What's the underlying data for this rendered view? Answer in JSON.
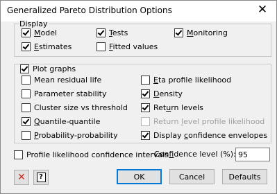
{
  "window": {
    "title": "Generalized Pareto Distribution Options",
    "close_glyph": "✕"
  },
  "display": {
    "legend": "Display",
    "items": [
      {
        "label_pre": "",
        "label_u": "M",
        "label_post": "odel",
        "checked": true
      },
      {
        "label_pre": "",
        "label_u": "T",
        "label_post": "ests",
        "checked": true
      },
      {
        "label_pre": "",
        "label_u": "M",
        "label_post": "onitoring",
        "checked": true
      },
      {
        "label_pre": "",
        "label_u": "E",
        "label_post": "stimates",
        "checked": true
      },
      {
        "label_pre": "",
        "label_u": "F",
        "label_post": "itted values",
        "checked": false
      }
    ]
  },
  "plot": {
    "legend": "Plot graphs",
    "checked": true,
    "left": [
      {
        "label_pre": "Mean residual life",
        "label_u": "",
        "label_post": "",
        "checked": false,
        "disabled": false
      },
      {
        "label_pre": "Parameter stability",
        "label_u": "",
        "label_post": "",
        "checked": false,
        "disabled": false
      },
      {
        "label_pre": "Cluster size vs threshold",
        "label_u": "",
        "label_post": "",
        "checked": false,
        "disabled": false
      },
      {
        "label_pre": "",
        "label_u": "Q",
        "label_post": "uantile-quantile",
        "checked": true,
        "disabled": false
      },
      {
        "label_pre": "",
        "label_u": "P",
        "label_post": "robability-probability",
        "checked": false,
        "disabled": false
      }
    ],
    "right": [
      {
        "label_pre": "",
        "label_u": "E",
        "label_post": "ta profile likelihood",
        "checked": false,
        "disabled": false
      },
      {
        "label_pre": "",
        "label_u": "D",
        "label_post": "ensity",
        "checked": true,
        "disabled": false
      },
      {
        "label_pre": "Ret",
        "label_u": "u",
        "label_post": "rn levels",
        "checked": true,
        "disabled": false
      },
      {
        "label_pre": "Return ",
        "label_u": "l",
        "label_post": "evel profile likelihood",
        "checked": false,
        "disabled": true
      },
      {
        "label_pre": "Display ",
        "label_u": "c",
        "label_post": "onfidence envelopes",
        "checked": true,
        "disabled": false
      }
    ]
  },
  "profile_ci": {
    "label": "Profile likelihood confidence intervals",
    "checked": false
  },
  "confidence": {
    "label_pre": "Con",
    "label_u": "f",
    "label_post": "idence level (%):",
    "value": "95"
  },
  "buttons": {
    "clear_glyph": "✕",
    "help_glyph": "?",
    "ok": "OK",
    "cancel": "Cancel",
    "defaults": "Defaults"
  },
  "colors": {
    "default_border": "#0078d7",
    "clear_red": "#c42b1c"
  }
}
